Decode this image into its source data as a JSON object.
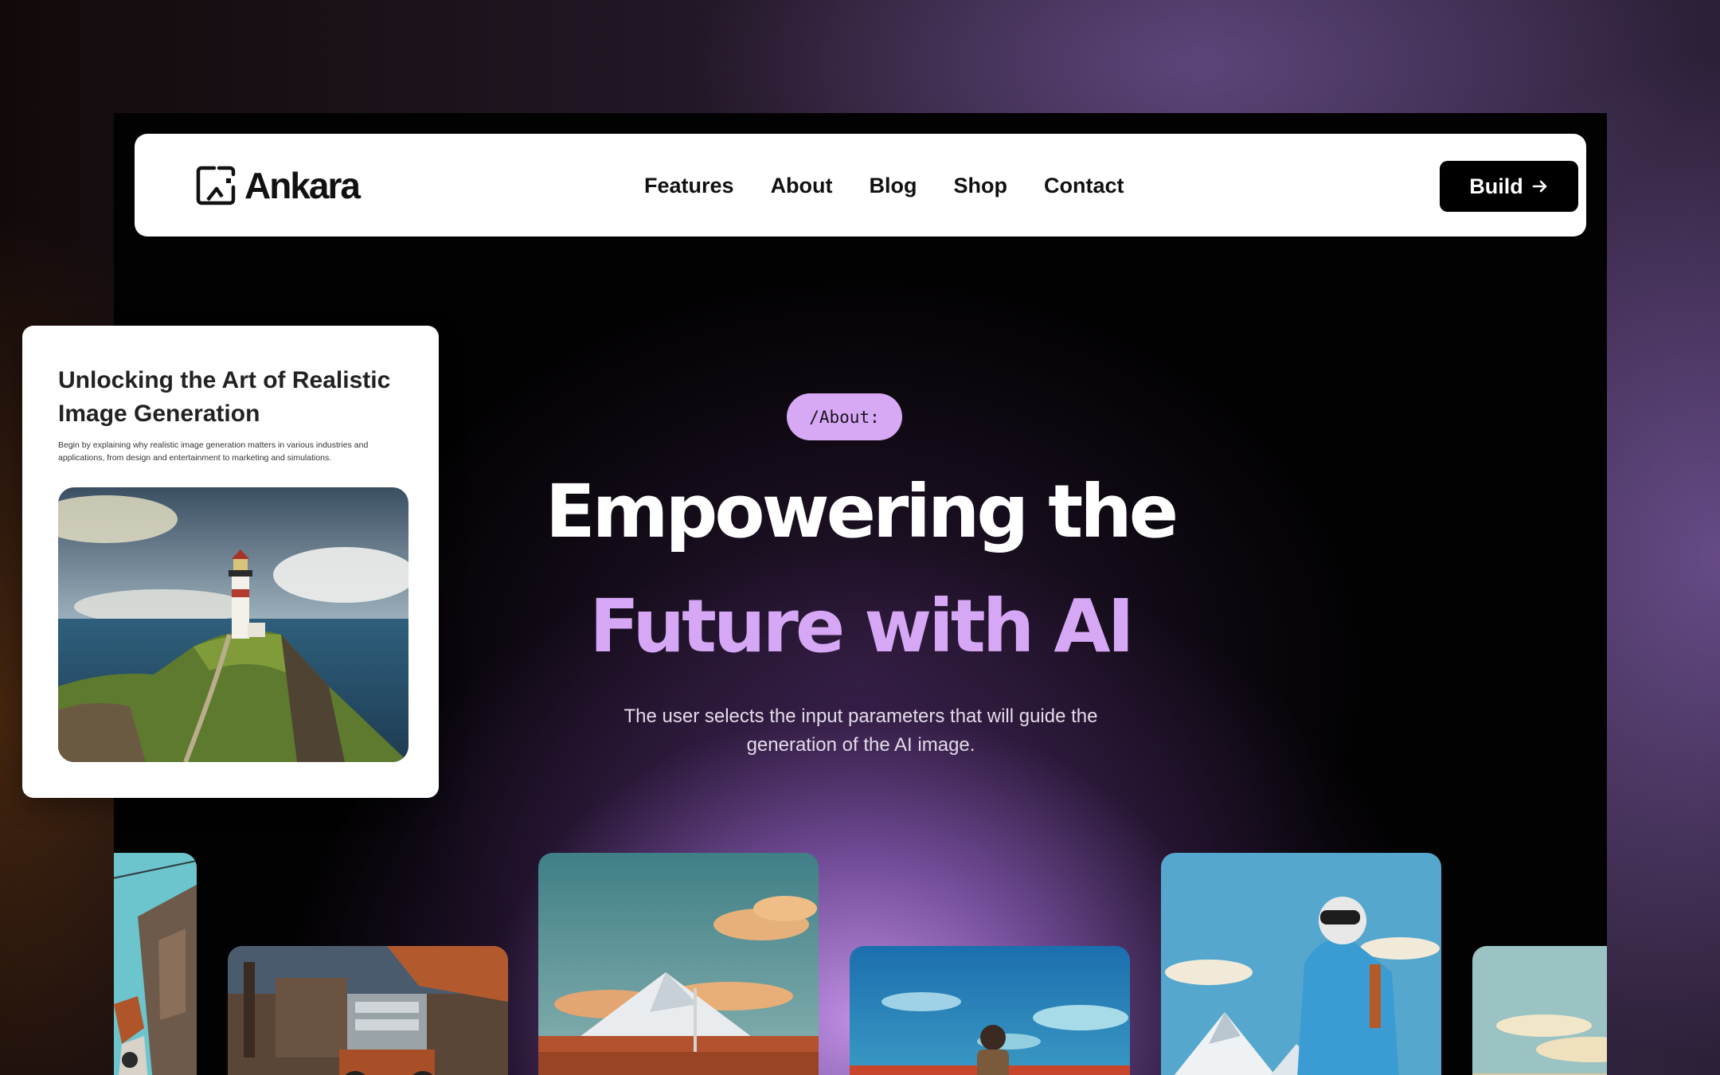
{
  "brand": {
    "name": "Ankara",
    "logo_icon": "image-frame-icon"
  },
  "nav": {
    "links": [
      "Features",
      "About",
      "Blog",
      "Shop",
      "Contact"
    ],
    "cta_label": "Build",
    "cta_icon": "arrow-right-icon"
  },
  "hero": {
    "tag": "/About:",
    "title_line1": "Empowering the",
    "title_line2": "Future with AI",
    "subtitle": "The user selects the input parameters that will guide the generation of the AI image."
  },
  "article_card": {
    "title": "Unlocking the Art of Realistic Image Generation",
    "description": "Begin by explaining why realistic image generation matters in various industries and applications, from design and entertainment to marketing and simulations."
  },
  "colors": {
    "accent": "#d6a7f4",
    "tag_bg": "#d7a8f4",
    "button_bg": "#000000",
    "nav_bg": "#ffffff",
    "stage_bg": "#030203"
  },
  "gallery": [
    {
      "icon": "illustration-figure-cropped"
    },
    {
      "icon": "illustration-steampunk-vehicle"
    },
    {
      "icon": "illustration-mountain-city"
    },
    {
      "icon": "illustration-pilot-sky"
    },
    {
      "icon": "illustration-mountaineer"
    },
    {
      "icon": "illustration-landscape-cropped"
    }
  ]
}
